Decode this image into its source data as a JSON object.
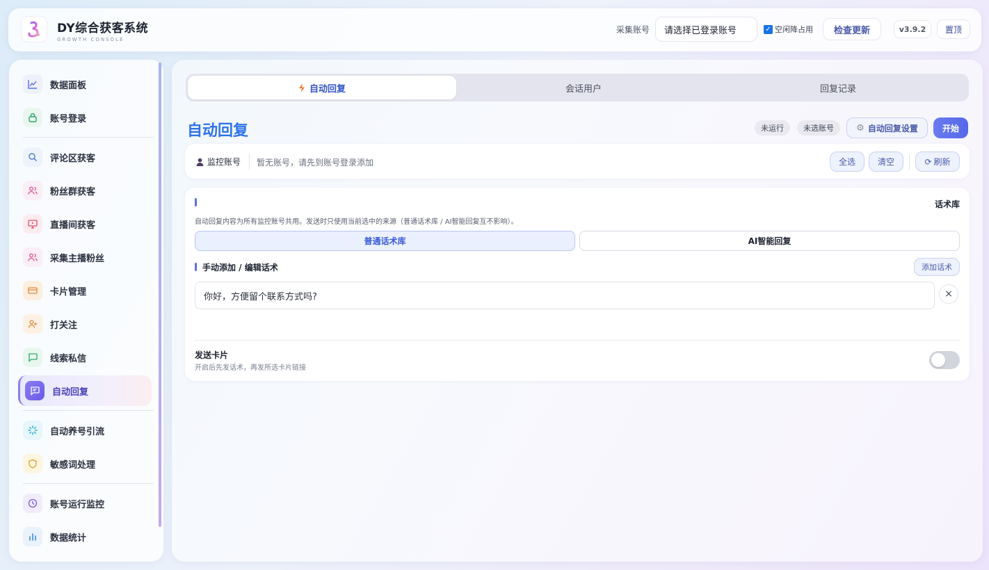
{
  "header": {
    "title": "DY综合获客系统",
    "subtitle": "GROWTH CONSOLE",
    "account_label": "采集账号",
    "account_select": "请选择已登录账号",
    "idle_checkbox_label": "空闲降占用",
    "idle_checked": true,
    "check_update": "检查更新",
    "version": "v3.9.2",
    "pin_top": "置顶"
  },
  "sidebar": {
    "items": [
      {
        "label": "数据面板",
        "icon": "line-chart-icon",
        "color": "#5b6ee8"
      },
      {
        "label": "账号登录",
        "icon": "lock-icon",
        "color": "#2aa56a"
      },
      {
        "label": "评论区获客",
        "icon": "search-icon",
        "color": "#4a7ad8"
      },
      {
        "label": "粉丝群获客",
        "icon": "users-icon",
        "color": "#d8589a"
      },
      {
        "label": "直播间获客",
        "icon": "monitor-icon",
        "color": "#e04a6a"
      },
      {
        "label": "采集主播粉丝",
        "icon": "users-icon",
        "color": "#d8589a"
      },
      {
        "label": "卡片管理",
        "icon": "card-icon",
        "color": "#e08a3a"
      },
      {
        "label": "打关注",
        "icon": "user-plus-icon",
        "color": "#e08a3a"
      },
      {
        "label": "线索私信",
        "icon": "message-icon",
        "color": "#2aa56a"
      },
      {
        "label": "自动回复",
        "icon": "reply-message-icon",
        "color": "#ffffff"
      },
      {
        "label": "自动养号引流",
        "icon": "loader-icon",
        "color": "#2aa8c8"
      },
      {
        "label": "敏感词处理",
        "icon": "shield-icon",
        "color": "#d8a030"
      },
      {
        "label": "账号运行监控",
        "icon": "clock-icon",
        "color": "#7a5ad8"
      },
      {
        "label": "数据统计",
        "icon": "bar-chart-icon",
        "color": "#3a8ad8"
      }
    ],
    "active_index": 9
  },
  "tabs": [
    {
      "label": "自动回复",
      "icon": "lightning-icon"
    },
    {
      "label": "会话用户"
    },
    {
      "label": "回复记录"
    }
  ],
  "page": {
    "title": "自动回复",
    "status_running": "未运行",
    "status_account": "未选账号",
    "settings_button": "自动回复设置",
    "start_button": "开始"
  },
  "monitor": {
    "label": "监控账号",
    "empty_text": "暂无账号，请先到账号登录添加",
    "select_all": "全选",
    "clear": "清空",
    "refresh": "刷新"
  },
  "library": {
    "title": "话术库",
    "description": "自动回复内容为所有监控账号共用。发送时只使用当前选中的来源（普通话术库 / AI智能回复互不影响）。",
    "source_normal": "普通话术库",
    "source_ai": "AI智能回复",
    "manual_title": "手动添加 / 编辑话术",
    "add_button": "添加话术",
    "entries": [
      "你好，方便留个联系方式吗?"
    ],
    "send_card_title": "发送卡片",
    "send_card_desc": "开启后先发话术，再发所选卡片链接",
    "send_card_enabled": false
  },
  "colors": {
    "accent": "#5b6ee8",
    "title_blue": "#2f74e8",
    "active_tab_text": "#3555c8"
  }
}
